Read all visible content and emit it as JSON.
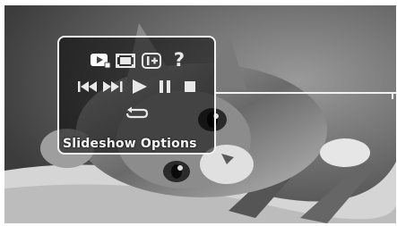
{
  "menu": {
    "label": "Slideshow Options",
    "icons": {
      "row1": [
        "slideshow-mode-icon",
        "slide-frame-icon",
        "info-icon",
        "help-icon"
      ],
      "row2": [
        "previous-icon",
        "next-icon",
        "play-icon",
        "pause-icon",
        "stop-icon"
      ],
      "row3": [
        "repeat-icon"
      ]
    },
    "help_glyph": "?",
    "selected_icon": "slideshow-mode-icon"
  },
  "colors": {
    "icon": "#e8e8e8",
    "border": "#f2f2f2",
    "panel_bg": "rgba(0,0,0,0.52)"
  }
}
